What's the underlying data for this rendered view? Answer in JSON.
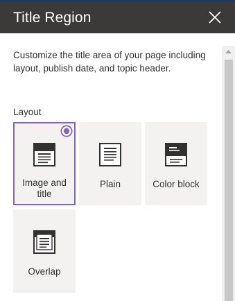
{
  "panel": {
    "title": "Title Region",
    "description": "Customize the title area of your page including layout, publish date, and topic header.",
    "section_label": "Layout"
  },
  "layouts": [
    {
      "label": "Image and title",
      "icon": "image-and-title-layout-icon",
      "selected": true
    },
    {
      "label": "Plain",
      "icon": "plain-layout-icon",
      "selected": false
    },
    {
      "label": "Color block",
      "icon": "color-block-layout-icon",
      "selected": false
    },
    {
      "label": "Overlap",
      "icon": "overlap-layout-icon",
      "selected": false
    }
  ],
  "colors": {
    "header_bg": "#3b3a39",
    "accent": "#8764b8",
    "tile_bg": "#f3f2f1",
    "text": "#323130"
  }
}
